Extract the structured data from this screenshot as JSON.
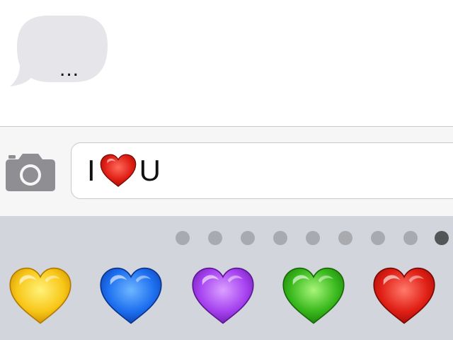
{
  "conversation": {
    "typing_indicator": "..."
  },
  "composer": {
    "camera_icon": "camera-icon",
    "text_before": "I",
    "inline_emoji": "red-heart",
    "text_after": "U"
  },
  "emoji_keyboard": {
    "page_count": 9,
    "active_page": 9,
    "hearts": [
      {
        "name": "yellow-heart",
        "color": "#f8c718"
      },
      {
        "name": "blue-heart",
        "color": "#1d6ff0"
      },
      {
        "name": "purple-heart",
        "color": "#a642f0"
      },
      {
        "name": "green-heart",
        "color": "#38b81c"
      },
      {
        "name": "red-heart",
        "color": "#e01f15"
      }
    ]
  },
  "colors": {
    "bubble_gray": "#e5e5ea",
    "keyboard_bg": "#d2d5db",
    "input_bar_bg": "#f6f6f7",
    "camera_gray": "#8e8e93"
  }
}
